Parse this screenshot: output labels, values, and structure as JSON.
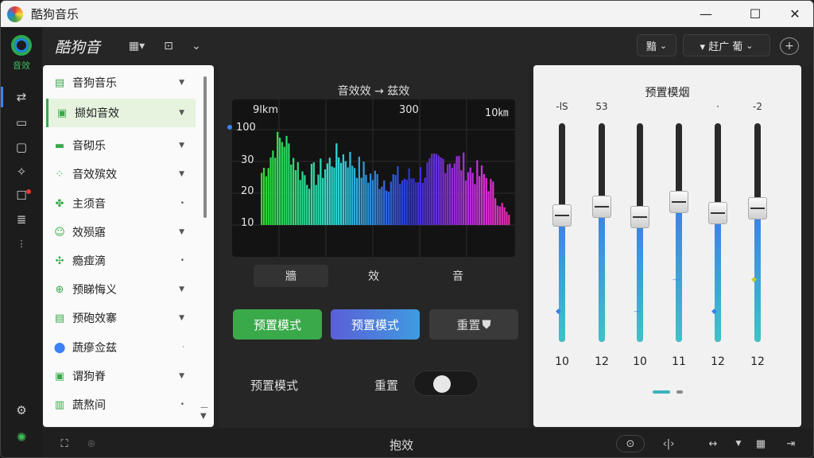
{
  "window": {
    "title": "酷狗音乐",
    "minimize": "—",
    "maximize": "☐",
    "close": "✕"
  },
  "rail": {
    "label": "音效"
  },
  "header": {
    "brand": "酷狗音",
    "box1": "黯",
    "box2_left": "▾  赶广",
    "box2_right": "葡"
  },
  "sidebar": {
    "items": [
      {
        "label": "音狗音乐",
        "icon": "chart-icon"
      },
      {
        "label": "撷如音效",
        "icon": "window-icon"
      },
      {
        "label": "音砌乐",
        "icon": "image-icon"
      },
      {
        "label": "音效殡效",
        "icon": "grid-icon"
      },
      {
        "label": "主须音",
        "icon": "flower-icon"
      },
      {
        "label": "效殒寤",
        "icon": "shield-icon"
      },
      {
        "label": "瘾痖滴",
        "icon": "clover-icon"
      },
      {
        "label": "预睇悔义",
        "icon": "plus-circle-icon"
      },
      {
        "label": "预砲效寨",
        "icon": "chart-icon"
      },
      {
        "label": "蔬瘮佥兹",
        "icon": "pin-icon"
      },
      {
        "label": "谓狗脊",
        "icon": "window-icon"
      },
      {
        "label": "蔬熬间",
        "icon": "cards-icon"
      }
    ]
  },
  "center": {
    "title": "音效效 → 兹效",
    "viz_labels": {
      "left": "9lkm",
      "mid": "300",
      "right": "10㎞"
    },
    "tabs": [
      "牆",
      "效",
      "音"
    ],
    "buttons": {
      "preset_green": "预置模式",
      "preset_blue": "预置模式",
      "reset": "重置"
    },
    "row": {
      "label": "预置模式",
      "toggle_label": "重置"
    }
  },
  "chart_data": {
    "type": "bar",
    "yticks": [
      "100",
      "30",
      "20",
      "10"
    ],
    "title": "音效效 → 兹效"
  },
  "equalizer": {
    "title": "预置模烟",
    "top_labels": [
      "-lS",
      "53",
      "",
      "",
      "·",
      "-2"
    ],
    "values": [
      "10",
      "12",
      "10",
      "11",
      "12",
      "12"
    ],
    "levels": [
      0.58,
      0.62,
      0.57,
      0.64,
      0.59,
      0.61
    ]
  },
  "bottom": {
    "title": "抱效"
  }
}
